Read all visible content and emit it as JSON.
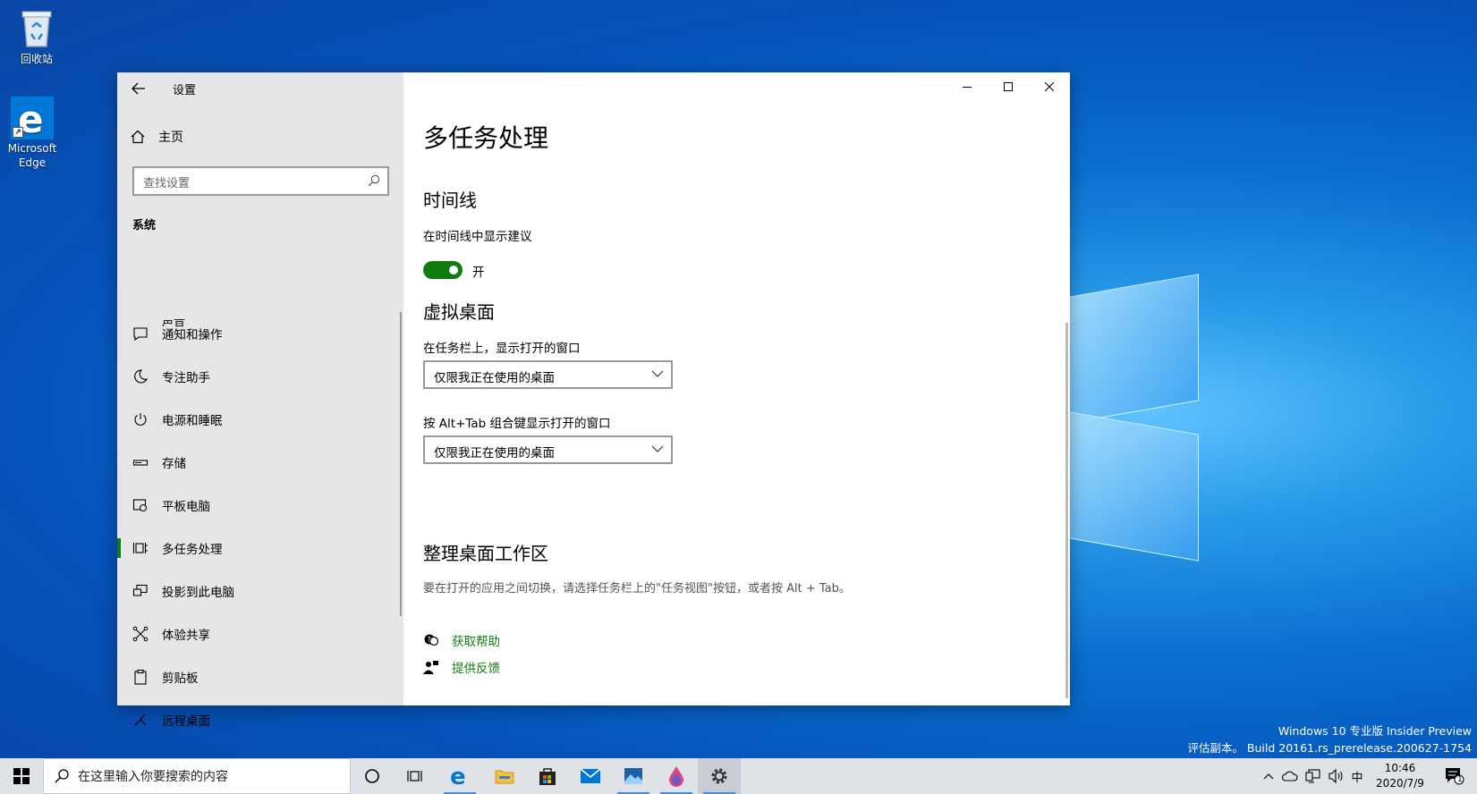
{
  "desktop": {
    "recycle_bin_label": "回收站",
    "edge_label": "Microsoft Edge"
  },
  "window": {
    "title": "设置",
    "sidebar": {
      "home_label": "主页",
      "search_placeholder": "查找设置",
      "section_label": "系统",
      "partial_item_label": "声音",
      "items": [
        {
          "label": "通知和操作",
          "icon": "message-icon"
        },
        {
          "label": "专注助手",
          "icon": "moon-icon"
        },
        {
          "label": "电源和睡眠",
          "icon": "power-icon"
        },
        {
          "label": "存储",
          "icon": "storage-icon"
        },
        {
          "label": "平板电脑",
          "icon": "tablet-icon"
        },
        {
          "label": "多任务处理",
          "icon": "multitask-icon"
        },
        {
          "label": "投影到此电脑",
          "icon": "project-icon"
        },
        {
          "label": "体验共享",
          "icon": "share-icon"
        },
        {
          "label": "剪贴板",
          "icon": "clipboard-icon"
        },
        {
          "label": "远程桌面",
          "icon": "remote-icon"
        }
      ]
    },
    "content": {
      "page_title": "多任务处理",
      "timeline_heading": "时间线",
      "timeline_suggestion_label": "在时间线中显示建议",
      "timeline_toggle_state": "开",
      "virtual_desktops_heading": "虚拟桌面",
      "taskbar_windows_label": "在任务栏上，显示打开的窗口",
      "taskbar_windows_value": "仅限我正在使用的桌面",
      "alttab_label": "按 Alt+Tab 组合键显示打开的窗口",
      "alttab_value": "仅限我正在使用的桌面",
      "tidy_heading": "整理桌面工作区",
      "tidy_desc": "要在打开的应用之间切换，请选择任务栏上的\"任务视图\"按钮，或者按 Alt + Tab。",
      "help_link": "获取帮助",
      "feedback_link": "提供反馈"
    }
  },
  "watermark": {
    "line1": "Windows 10 专业版 Insider Preview",
    "line2": "评估副本。 Build 20161.rs_prerelease.200627-1754"
  },
  "taskbar": {
    "search_placeholder": "在这里输入你要搜索的内容",
    "ime": "中",
    "time": "10:46",
    "date": "2020/7/9",
    "notification_count": "1"
  },
  "colors": {
    "accent": "#107c10",
    "sidebar_bg": "#e6e6e6",
    "taskbar_bg": "#dfe3e8"
  }
}
